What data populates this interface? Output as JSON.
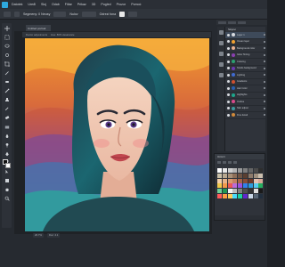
{
  "menu": {
    "items": [
      "Datotek",
      "Uređi",
      "Sloj",
      "Odab",
      "Filtar",
      "Prikaz",
      "3D",
      "Pogled",
      "Prozor",
      "Pomoć"
    ]
  },
  "options": {
    "label_a": "Segmeny: 0 Neusy",
    "label_b": "Nulov",
    "label_c": "Odrezi fona"
  },
  "document": {
    "tab_title": "Untitled portrait",
    "ruler_labels": [
      "Doctor adjustments",
      "Hue: 80% desaturate"
    ],
    "status": [
      "26.7%",
      "Doc: 4.1"
    ]
  },
  "layers_panel": {
    "title": "Slojevi",
    "layers": [
      {
        "name": "Layer 1",
        "color": "#d7dadf",
        "active": true
      },
      {
        "name": "Ocean layer",
        "color": "#f0a030",
        "active": false
      },
      {
        "name": "Background color",
        "color": "#e8b090",
        "active": false
      },
      {
        "name": "Glow Tinting",
        "color": "#8a3fb0",
        "active": false
      },
      {
        "name": "Coloring",
        "color": "#2aa070",
        "active": false
      },
      {
        "name": "Studio background",
        "color": "#6b3ab0",
        "active": false
      },
      {
        "name": "Lighting",
        "color": "#3f6ad0",
        "active": false
      },
      {
        "name": "Gradients",
        "color": "#d05030",
        "active": false
      },
      {
        "name": "Hair Color",
        "color": "#2a5fb0",
        "active": false
      },
      {
        "name": "Highlights",
        "color": "#1da58a",
        "active": false
      },
      {
        "name": "Outline",
        "color": "#d94a8a",
        "active": false
      },
      {
        "name": "Skin adjust",
        "color": "#3b9a9e",
        "active": false
      },
      {
        "name": "Fine detail",
        "color": "#d08a3a",
        "active": false
      }
    ]
  },
  "color_panel": {
    "title": "Uzorci",
    "swatches": [
      "#ffffff",
      "#e9e9e9",
      "#cfcfcf",
      "#b5b5b5",
      "#9a9a9a",
      "#7f7f7f",
      "#666666",
      "#4a4a4a",
      "#2e2e2e",
      "#c9c0a8",
      "#b8a890",
      "#a89078",
      "#8c6e58",
      "#6f5443",
      "#5a3f31",
      "#8c7a6a",
      "#a0917f",
      "#cbbfae",
      "#f4d0a8",
      "#e8b48a",
      "#d89a72",
      "#c48060",
      "#a86448",
      "#8a4c36",
      "#6e3828",
      "#e6c2b0",
      "#d6a898",
      "#f2c94c",
      "#f2994a",
      "#eb5757",
      "#bb6bd9",
      "#9b51e0",
      "#2f80ed",
      "#2d9cdb",
      "#56ccf2",
      "#27ae60",
      "#6fcf97",
      "#219653",
      "#f2f2f2",
      "#bdbdbd",
      "#828282",
      "#4f4f4f",
      "#333333",
      "#e0e0e0",
      "#1a1a1a",
      "#ff5a5a",
      "#ff9f43",
      "#feca57",
      "#48dbfb",
      "#1dd1a1",
      "#5f27cd",
      "#c8d6e5",
      "#576574",
      "#222f3e"
    ]
  },
  "colors": {
    "accent": "#2ea8dd",
    "panel_bg": "#2f333a",
    "app_bg": "#262a30"
  },
  "tools": [
    "move-tool-icon",
    "marquee-tool-icon",
    "lasso-tool-icon",
    "quick-select-icon",
    "crop-tool-icon",
    "eyedropper-icon",
    "healing-brush-icon",
    "brush-tool-icon",
    "clone-stamp-icon",
    "history-brush-icon",
    "eraser-tool-icon",
    "gradient-tool-icon",
    "blur-tool-icon",
    "dodge-tool-icon",
    "pen-tool-icon",
    "type-tool-icon",
    "path-select-icon",
    "shape-tool-icon",
    "hand-tool-icon",
    "zoom-tool-icon"
  ]
}
